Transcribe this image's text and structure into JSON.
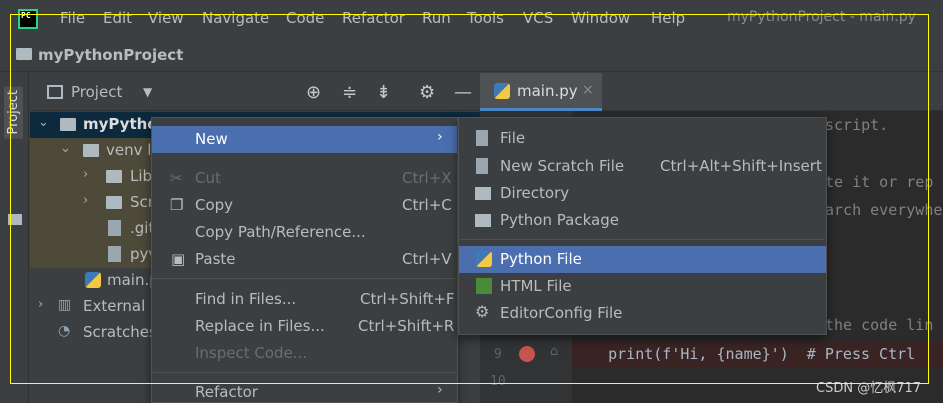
{
  "menubar": {
    "items": [
      "File",
      "Edit",
      "View",
      "Navigate",
      "Code",
      "Refactor",
      "Run",
      "Tools",
      "VCS",
      "Window",
      "Help"
    ],
    "window_title": "myPythonProject - main.py"
  },
  "navbar": {
    "project_name": "myPythonProject"
  },
  "sidestrip": {
    "label": "Project"
  },
  "project_panel": {
    "title": "Project",
    "caret": "▼"
  },
  "tree": {
    "items": [
      {
        "label": "myPytho",
        "arrow": "⌄"
      },
      {
        "label": "venv  li",
        "arrow": "⌄"
      },
      {
        "label": "Lib",
        "arrow": "›"
      },
      {
        "label": "Scr",
        "arrow": "›"
      },
      {
        "label": ".git"
      },
      {
        "label": "pyv"
      },
      {
        "label": "main.p"
      },
      {
        "label": "External L",
        "arrow": "›"
      },
      {
        "label": "Scratches"
      }
    ]
  },
  "tab": {
    "label": "main.py",
    "close": "×"
  },
  "editor": {
    "lines": [
      {
        "text": "script."
      },
      {
        "text": "te it or rep"
      },
      {
        "text": "arch everywhe"
      },
      {
        "text": "the code lin"
      },
      {
        "num": "9",
        "text": "    print(f'Hi, {name}')  # Press Ctrl"
      },
      {
        "num": "10",
        "text": ""
      }
    ]
  },
  "context_menu": {
    "items": [
      {
        "label": "New",
        "shortcut": "",
        "submenu": "›"
      },
      {
        "label": "Cut",
        "shortcut": "Ctrl+X"
      },
      {
        "label": "Copy",
        "shortcut": "Ctrl+C"
      },
      {
        "label": "Copy Path/Reference...",
        "shortcut": ""
      },
      {
        "label": "Paste",
        "shortcut": "Ctrl+V"
      },
      {
        "label": "Find in Files...",
        "shortcut": "Ctrl+Shift+F"
      },
      {
        "label": "Replace in Files...",
        "shortcut": "Ctrl+Shift+R"
      },
      {
        "label": "Inspect Code...",
        "shortcut": ""
      },
      {
        "label": "Refactor",
        "shortcut": "",
        "submenu": "›"
      }
    ]
  },
  "new_submenu": {
    "items": [
      {
        "label": "File",
        "shortcut": ""
      },
      {
        "label": "New Scratch File",
        "shortcut": "Ctrl+Alt+Shift+Insert"
      },
      {
        "label": "Directory",
        "shortcut": ""
      },
      {
        "label": "Python Package",
        "shortcut": ""
      },
      {
        "label": "Python File",
        "shortcut": ""
      },
      {
        "label": "HTML File",
        "shortcut": ""
      },
      {
        "label": "EditorConfig File",
        "shortcut": ""
      }
    ]
  },
  "watermark": "CSDN @忆枫717",
  "colors": {
    "selection": "#4b6eaf",
    "accent_border": "#ffff00",
    "breakpoint": "#c75450"
  }
}
